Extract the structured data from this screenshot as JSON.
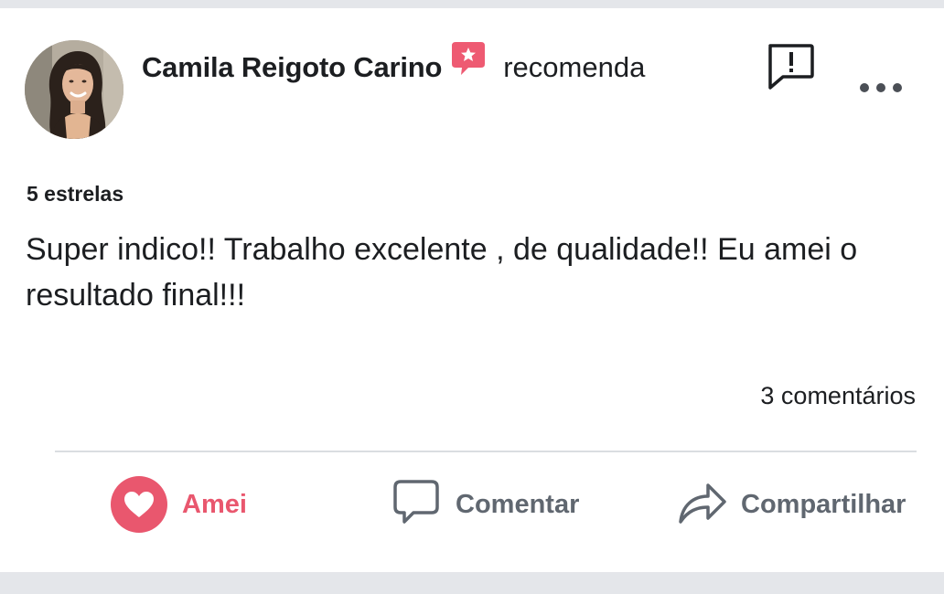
{
  "post": {
    "author_name": "Camila Reigoto Carino",
    "action_text": "recomenda",
    "rating_text": "5 estrelas",
    "review_text": "Super indico!! Trabalho excelente , de qualidade!! Eu amei o resultado final!!!",
    "comments_count": "3 comentários",
    "icons": {
      "avatar": "profile-photo",
      "recommend": "recommendation-star-bubble-icon",
      "report": "report-flag-icon",
      "more": "more-options-icon"
    }
  },
  "actions": {
    "love_label": "Amei",
    "comment_label": "Comentar",
    "share_label": "Compartilhar",
    "icons": {
      "love": "heart-icon",
      "comment": "comment-bubble-icon",
      "share": "share-arrow-icon"
    }
  },
  "colors": {
    "love_accent": "#e9576e",
    "text_primary": "#1c1e21",
    "text_secondary": "#606770",
    "divider": "#dadde1",
    "frame": "#e4e6ea"
  }
}
